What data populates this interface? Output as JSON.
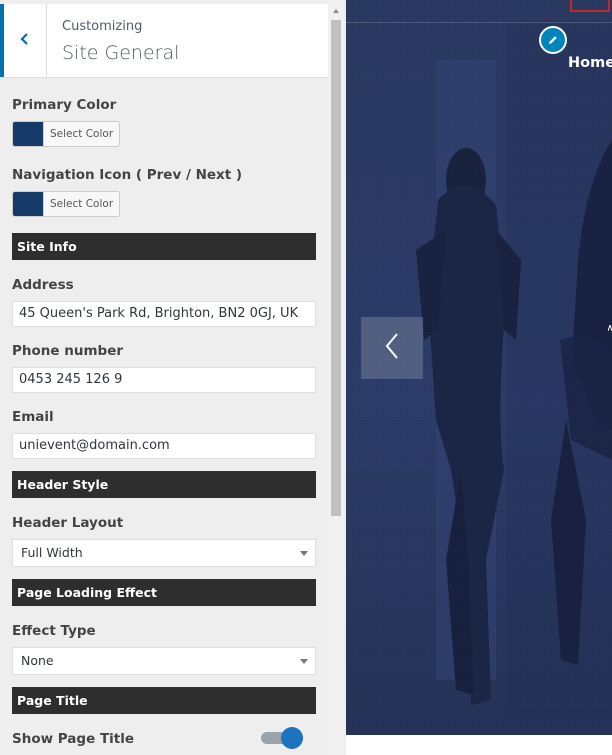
{
  "header": {
    "crumb": "Customizing",
    "title": "Site General"
  },
  "colors": {
    "accent": "#0073aa",
    "swatch": "#163b68",
    "section_bg": "#2e2e2e"
  },
  "controls": {
    "primary_color": {
      "label": "Primary Color",
      "button": "Select Color"
    },
    "nav_icon_color": {
      "label": "Navigation Icon ( Prev / Next )",
      "button": "Select Color"
    }
  },
  "site_info": {
    "heading": "Site Info",
    "address": {
      "label": "Address",
      "value": "45 Queen's Park Rd, Brighton, BN2 0GJ, UK"
    },
    "phone": {
      "label": "Phone number",
      "value": "0453 245 126 9"
    },
    "email": {
      "label": "Email",
      "value": "unievent@domain.com"
    }
  },
  "header_style": {
    "heading": "Header Style",
    "layout_label": "Header Layout",
    "layout_value": "Full Width"
  },
  "page_loading": {
    "heading": "Page Loading Effect",
    "effect_label": "Effect Type",
    "effect_value": "None"
  },
  "page_title": {
    "heading": "Page Title",
    "show_label": "Show Page Title",
    "show_enabled": true
  },
  "preview": {
    "nav_home": "Home"
  }
}
